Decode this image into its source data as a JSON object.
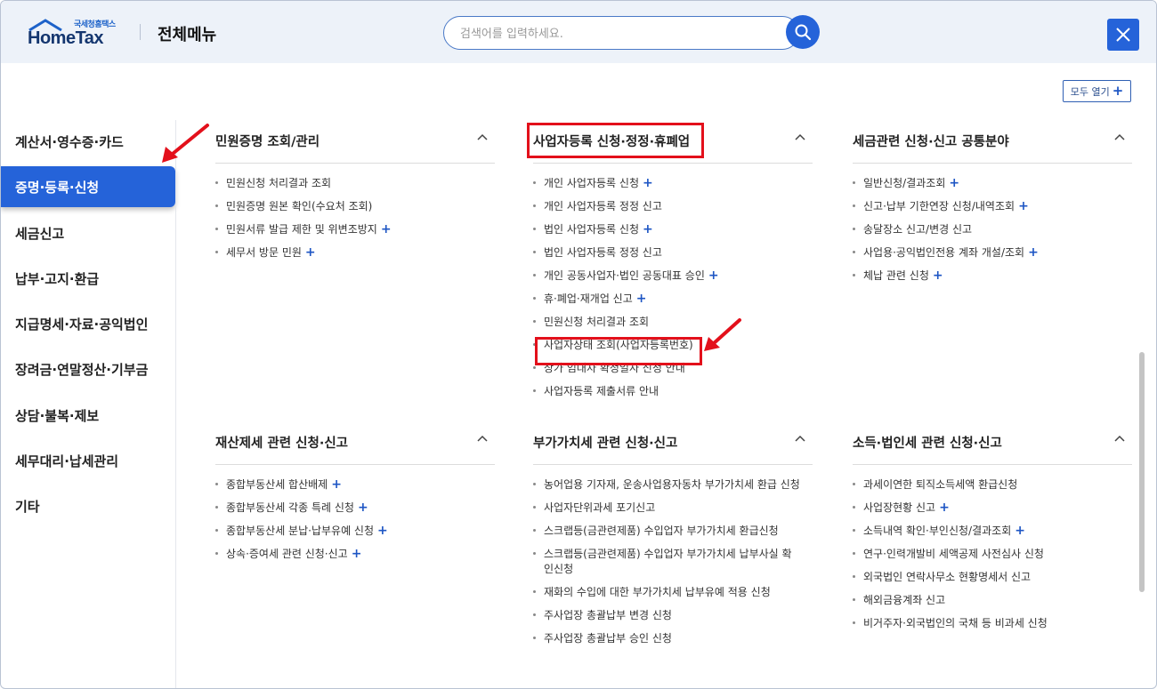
{
  "header": {
    "logo_small": "국세청홈택스",
    "logo_main": "HomeTax",
    "title": "전체메뉴",
    "search_placeholder": "검색어를 입력하세요."
  },
  "expand_all_label": "모두 열기",
  "sidebar": {
    "items": [
      {
        "label": "계산서·영수증·카드",
        "active": false
      },
      {
        "label": "증명·등록·신청",
        "active": true
      },
      {
        "label": "세금신고",
        "active": false
      },
      {
        "label": "납부·고지·환급",
        "active": false
      },
      {
        "label": "지급명세·자료·공익법인",
        "active": false
      },
      {
        "label": "장려금·연말정산·기부금",
        "active": false
      },
      {
        "label": "상담·불복·제보",
        "active": false
      },
      {
        "label": "세무대리·납세관리",
        "active": false
      },
      {
        "label": "기타",
        "active": false
      }
    ]
  },
  "sections": [
    {
      "title": "민원증명 조회/관리",
      "items": [
        {
          "label": "민원신청 처리결과 조회",
          "plus": false
        },
        {
          "label": "민원증명 원본 확인(수요처 조회)",
          "plus": false
        },
        {
          "label": "민원서류 발급 제한 및 위변조방지",
          "plus": true
        },
        {
          "label": "세무서 방문 민원",
          "plus": true
        }
      ]
    },
    {
      "title": "사업자등록 신청·정정·휴폐업",
      "items": [
        {
          "label": "개인 사업자등록 신청",
          "plus": true
        },
        {
          "label": "개인 사업자등록 정정 신고",
          "plus": false
        },
        {
          "label": "법인 사업자등록 신청",
          "plus": true
        },
        {
          "label": "법인 사업자등록 정정 신고",
          "plus": false
        },
        {
          "label": "개인 공동사업자·법인 공동대표 승인",
          "plus": true
        },
        {
          "label": "휴·폐업·재개업 신고",
          "plus": true
        },
        {
          "label": "민원신청 처리결과 조회",
          "plus": false
        },
        {
          "label": "사업자상태 조회(사업자등록번호)",
          "plus": false
        },
        {
          "label": "상가 임대차 확정일자 신청 안내",
          "plus": false
        },
        {
          "label": "사업자등록 제출서류 안내",
          "plus": false
        }
      ]
    },
    {
      "title": "세금관련 신청·신고 공통분야",
      "items": [
        {
          "label": "일반신청/결과조회",
          "plus": true
        },
        {
          "label": "신고·납부 기한연장 신청/내역조회",
          "plus": true
        },
        {
          "label": "송달장소 신고/변경 신고",
          "plus": false
        },
        {
          "label": "사업용·공익법인전용 계좌 개설/조회",
          "plus": true
        },
        {
          "label": "체납 관련 신청",
          "plus": true
        }
      ]
    },
    {
      "title": "재산제세 관련 신청·신고",
      "items": [
        {
          "label": "종합부동산세 합산배제",
          "plus": true
        },
        {
          "label": "종합부동산세 각종 특례 신청",
          "plus": true
        },
        {
          "label": "종합부동산세 분납·납부유예 신청",
          "plus": true
        },
        {
          "label": "상속·증여세 관련 신청·신고",
          "plus": true
        }
      ]
    },
    {
      "title": "부가가치세 관련 신청·신고",
      "items": [
        {
          "label": "농어업용 기자재, 운송사업용자동차 부가가치세 환급 신청",
          "plus": false
        },
        {
          "label": "사업자단위과세 포기신고",
          "plus": false
        },
        {
          "label": "스크랩등(금관련제품) 수입업자 부가가치세 환급신청",
          "plus": false
        },
        {
          "label": "스크랩등(금관련제품) 수입업자 부가가치세 납부사실 확인신청",
          "plus": false
        },
        {
          "label": "재화의 수입에 대한 부가가치세 납부유예 적용 신청",
          "plus": false
        },
        {
          "label": "주사업장 총괄납부 변경 신청",
          "plus": false
        },
        {
          "label": "주사업장 총괄납부 승인 신청",
          "plus": false
        }
      ]
    },
    {
      "title": "소득·법인세 관련 신청·신고",
      "items": [
        {
          "label": "과세이연한 퇴직소득세액 환급신청",
          "plus": false
        },
        {
          "label": "사업장현황 신고",
          "plus": true
        },
        {
          "label": "소득내역 확인·부인신청/결과조회",
          "plus": true
        },
        {
          "label": "연구·인력개발비 세액공제 사전심사 신청",
          "plus": false
        },
        {
          "label": "외국법인 연락사무소 현황명세서 신고",
          "plus": false
        },
        {
          "label": "해외금융계좌 신고",
          "plus": false
        },
        {
          "label": "비거주자·외국법인의 국채 등 비과세 신청",
          "plus": false
        }
      ]
    }
  ],
  "accent_color": "#2563d9",
  "highlight_color": "#e3101b"
}
